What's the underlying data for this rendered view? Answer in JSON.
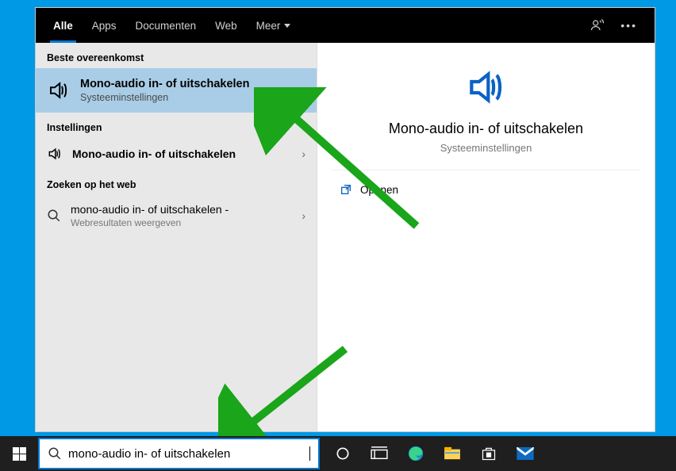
{
  "tabs": {
    "all": "Alle",
    "apps": "Apps",
    "documents": "Documenten",
    "web": "Web",
    "more": "Meer"
  },
  "left": {
    "best_match_label": "Beste overeenkomst",
    "best_match": {
      "title": "Mono-audio in- of uitschakelen",
      "subtitle": "Systeeminstellingen"
    },
    "settings_label": "Instellingen",
    "settings_item": {
      "title": "Mono-audio in- of uitschakelen"
    },
    "web_label": "Zoeken op het web",
    "web_item": {
      "title": "mono-audio in- of uitschakelen -",
      "subtitle": "Webresultaten weergeven"
    }
  },
  "preview": {
    "title": "Mono-audio in- of uitschakelen",
    "subtitle": "Systeeminstellingen",
    "open": "Openen"
  },
  "search": {
    "value": "mono-audio in- of uitschakelen"
  }
}
